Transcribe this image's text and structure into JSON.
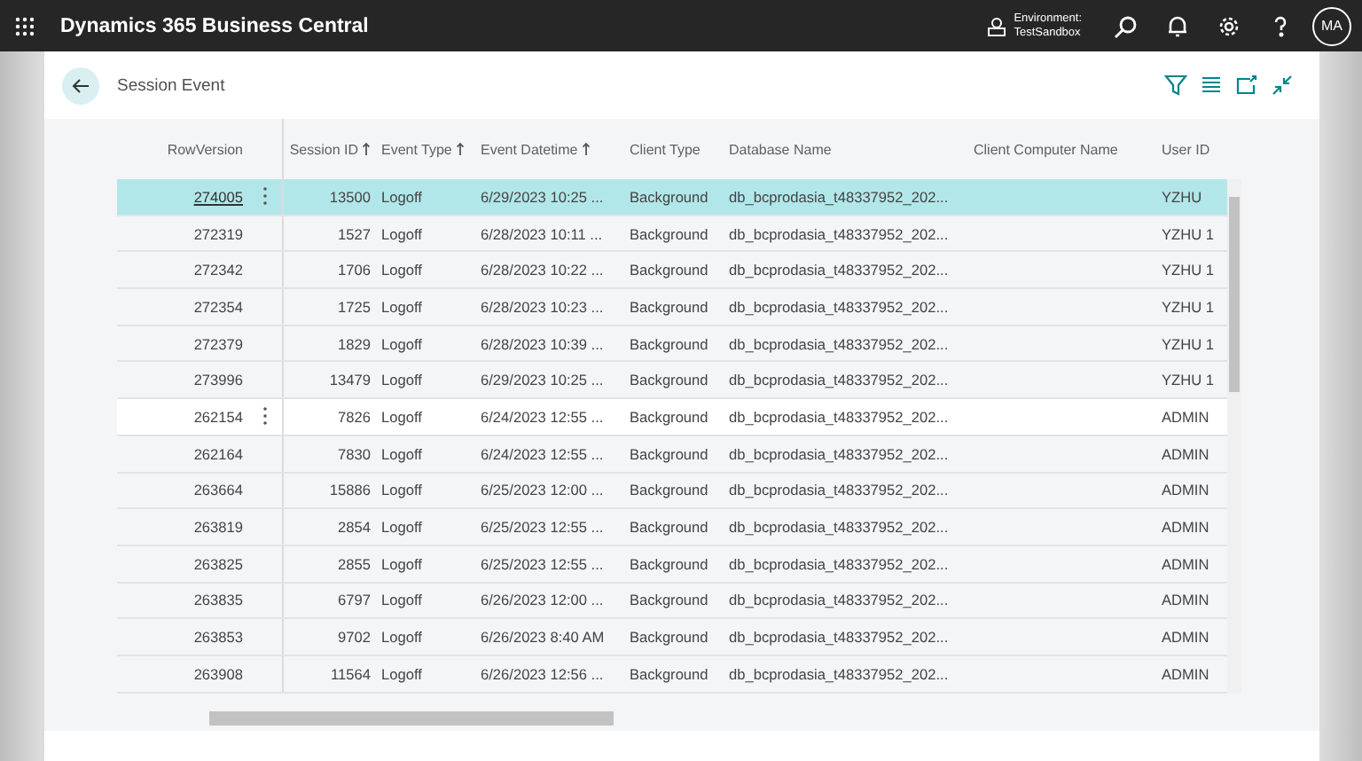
{
  "top_bar": {
    "app_title": "Dynamics 365 Business Central",
    "environment_label": "Environment:",
    "environment_name": "TestSandbox",
    "avatar_initials": "MA"
  },
  "page": {
    "title": "Session Event"
  },
  "table": {
    "columns": [
      {
        "label": "RowVersion",
        "sorted": false
      },
      {
        "label": "Session ID",
        "sorted": true
      },
      {
        "label": "Event Type",
        "sorted": true
      },
      {
        "label": "Event Datetime",
        "sorted": true
      },
      {
        "label": "Client Type",
        "sorted": false
      },
      {
        "label": "Database Name",
        "sorted": false
      },
      {
        "label": "Client Computer Name",
        "sorted": false
      },
      {
        "label": "User ID",
        "sorted": false
      }
    ],
    "rows": [
      {
        "selected": true,
        "hovered": false,
        "cells": [
          "274005",
          "13500",
          "Logoff",
          "6/29/2023 10:25 ...",
          "Background",
          "db_bcprodasia_t48337952_202...",
          "",
          "YZHU"
        ]
      },
      {
        "selected": false,
        "hovered": false,
        "cells": [
          "272319",
          "1527",
          "Logoff",
          "6/28/2023 10:11 ...",
          "Background",
          "db_bcprodasia_t48337952_202...",
          "",
          "YZHU 1"
        ]
      },
      {
        "selected": false,
        "hovered": false,
        "cells": [
          "272342",
          "1706",
          "Logoff",
          "6/28/2023 10:22 ...",
          "Background",
          "db_bcprodasia_t48337952_202...",
          "",
          "YZHU 1"
        ]
      },
      {
        "selected": false,
        "hovered": false,
        "cells": [
          "272354",
          "1725",
          "Logoff",
          "6/28/2023 10:23 ...",
          "Background",
          "db_bcprodasia_t48337952_202...",
          "",
          "YZHU 1"
        ]
      },
      {
        "selected": false,
        "hovered": false,
        "cells": [
          "272379",
          "1829",
          "Logoff",
          "6/28/2023 10:39 ...",
          "Background",
          "db_bcprodasia_t48337952_202...",
          "",
          "YZHU 1"
        ]
      },
      {
        "selected": false,
        "hovered": false,
        "cells": [
          "273996",
          "13479",
          "Logoff",
          "6/29/2023 10:25 ...",
          "Background",
          "db_bcprodasia_t48337952_202...",
          "",
          "YZHU 1"
        ]
      },
      {
        "selected": false,
        "hovered": true,
        "cells": [
          "262154",
          "7826",
          "Logoff",
          "6/24/2023 12:55 ...",
          "Background",
          "db_bcprodasia_t48337952_202...",
          "",
          "ADMIN"
        ]
      },
      {
        "selected": false,
        "hovered": false,
        "cells": [
          "262164",
          "7830",
          "Logoff",
          "6/24/2023 12:55 ...",
          "Background",
          "db_bcprodasia_t48337952_202...",
          "",
          "ADMIN"
        ]
      },
      {
        "selected": false,
        "hovered": false,
        "cells": [
          "263664",
          "15886",
          "Logoff",
          "6/25/2023 12:00 ...",
          "Background",
          "db_bcprodasia_t48337952_202...",
          "",
          "ADMIN"
        ]
      },
      {
        "selected": false,
        "hovered": false,
        "cells": [
          "263819",
          "2854",
          "Logoff",
          "6/25/2023 12:55 ...",
          "Background",
          "db_bcprodasia_t48337952_202...",
          "",
          "ADMIN"
        ]
      },
      {
        "selected": false,
        "hovered": false,
        "cells": [
          "263825",
          "2855",
          "Logoff",
          "6/25/2023 12:55 ...",
          "Background",
          "db_bcprodasia_t48337952_202...",
          "",
          "ADMIN"
        ]
      },
      {
        "selected": false,
        "hovered": false,
        "cells": [
          "263835",
          "6797",
          "Logoff",
          "6/26/2023 12:00 ...",
          "Background",
          "db_bcprodasia_t48337952_202...",
          "",
          "ADMIN"
        ]
      },
      {
        "selected": false,
        "hovered": false,
        "cells": [
          "263853",
          "9702",
          "Logoff",
          "6/26/2023 8:40 AM",
          "Background",
          "db_bcprodasia_t48337952_202...",
          "",
          "ADMIN"
        ]
      },
      {
        "selected": false,
        "hovered": false,
        "cells": [
          "263908",
          "11564",
          "Logoff",
          "6/26/2023 12:56 ...",
          "Background",
          "db_bcprodasia_t48337952_202...",
          "",
          "ADMIN"
        ]
      }
    ]
  }
}
